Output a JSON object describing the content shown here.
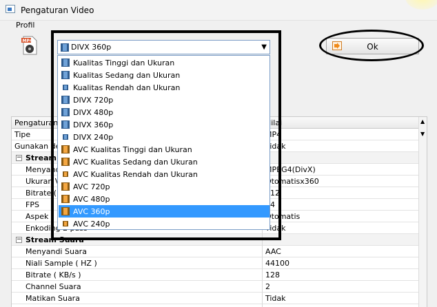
{
  "window": {
    "title": "Pengaturan Video"
  },
  "profil": {
    "label": "Profil",
    "selected": "DIVX 360p",
    "options": [
      {
        "label": "Kualitas Tinggi dan Ukuran",
        "icon": "film-blue-icon"
      },
      {
        "label": "Kualitas Sedang dan Ukuran",
        "icon": "film-blue-icon"
      },
      {
        "label": "Kualitas Rendah dan Ukuran",
        "icon": "film-blue-small-icon"
      },
      {
        "label": "DIVX 720p",
        "icon": "film-blue-icon"
      },
      {
        "label": "DIVX 480p",
        "icon": "film-blue-icon"
      },
      {
        "label": "DIVX 360p",
        "icon": "film-blue-icon"
      },
      {
        "label": "DIVX 240p",
        "icon": "film-blue-small-icon"
      },
      {
        "label": "AVC Kualitas Tinggi dan Ukuran",
        "icon": "film-orange-icon"
      },
      {
        "label": "AVC Kualitas Sedang dan Ukuran",
        "icon": "film-orange-icon"
      },
      {
        "label": "AVC Kualitas Rendah dan Ukuran",
        "icon": "film-orange-small-icon"
      },
      {
        "label": "AVC 720p",
        "icon": "film-orange-icon"
      },
      {
        "label": "AVC 480p",
        "icon": "film-orange-icon"
      },
      {
        "label": "AVC 360p",
        "icon": "film-orange-icon",
        "highlighted": true
      },
      {
        "label": "AVC 240p",
        "icon": "film-orange-small-icon"
      }
    ]
  },
  "ok_button": {
    "label": "Ok"
  },
  "grid": {
    "header": {
      "col1": "Pengaturan",
      "col2": "Nilai"
    },
    "rows": [
      {
        "type": "row",
        "name": "Tipe",
        "value": "MP4"
      },
      {
        "type": "row",
        "name": "Gunakan default",
        "value": "Tidak"
      },
      {
        "type": "section",
        "name": "Stream Video"
      },
      {
        "type": "row",
        "indent": true,
        "name": "Menyandi",
        "value": "MPEG4(DivX)"
      },
      {
        "type": "row",
        "indent": true,
        "name": "Ukuran Video",
        "value": "Otomatisx360"
      },
      {
        "type": "row",
        "indent": true,
        "name": "Bitrate ( KB/s )",
        "value": "512"
      },
      {
        "type": "row",
        "indent": true,
        "name": "FPS",
        "value": "24"
      },
      {
        "type": "row",
        "indent": true,
        "name": "Aspek",
        "value": "Otomatis"
      },
      {
        "type": "row",
        "indent": true,
        "name": "Enkoding 2 pass",
        "value": "Tidak"
      },
      {
        "type": "section",
        "name": "Stream Suara"
      },
      {
        "type": "row",
        "indent": true,
        "name": "Menyandi Suara",
        "value": "AAC"
      },
      {
        "type": "row",
        "indent": true,
        "name": "Niali Sample ( HZ )",
        "value": "44100"
      },
      {
        "type": "row",
        "indent": true,
        "name": "Bitrate ( KB/s )",
        "value": "128"
      },
      {
        "type": "row",
        "indent": true,
        "name": "Channel Suara",
        "value": "2"
      },
      {
        "type": "row",
        "indent": true,
        "name": "Matikan Suara",
        "value": "Tidak"
      }
    ]
  },
  "colors": {
    "selection": "#3399ff",
    "combo_border": "#7a9cc6",
    "annotation": "#000000"
  }
}
